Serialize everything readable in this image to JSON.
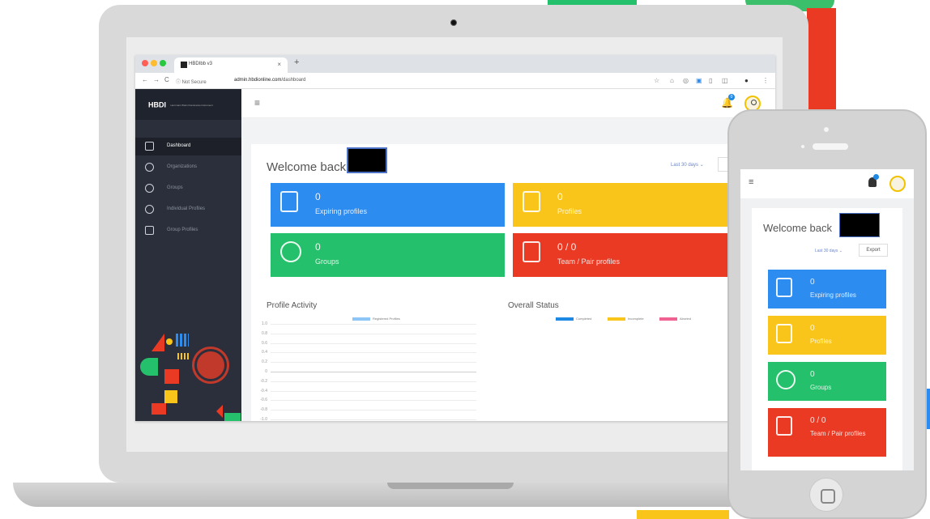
{
  "browser": {
    "tab_title": "HBDIbb v3",
    "tab_close": "×",
    "new_tab": "+",
    "nav_icons": [
      "←",
      "→",
      "C"
    ],
    "security_label": "ⓘ Not Secure",
    "url_host": "admin.hbdionline.com",
    "url_path": "/dashboard",
    "toolbar_icons": [
      "☆",
      "⌂",
      "◎",
      "▣",
      "▯",
      "◫",
      "●",
      "⋮"
    ]
  },
  "sidebar": {
    "brand": "HBDI",
    "brand_tagline": "Herrmann Brain Dominance Instrument",
    "items": [
      {
        "label": "Dashboard",
        "icon": "dashboard-icon"
      },
      {
        "label": "Organizations",
        "icon": "organization-icon"
      },
      {
        "label": "Groups",
        "icon": "groups-icon"
      },
      {
        "label": "Individual Profiles",
        "icon": "individual-profile-icon"
      },
      {
        "label": "Group Profiles",
        "icon": "group-profile-icon"
      }
    ]
  },
  "topbar": {
    "menu_glyph": "≡",
    "bell_glyph": "🔔",
    "notification_count": "0"
  },
  "dashboard": {
    "welcome": "Welcome back",
    "date_range": "Last 30 days ⌄",
    "cards": [
      {
        "value": "0",
        "label": "Expiring profiles",
        "color": "#2d8cf0"
      },
      {
        "value": "0",
        "label": "Profiles",
        "color": "#f9c51b"
      },
      {
        "value": "0",
        "label": "Groups",
        "color": "#25c06b"
      },
      {
        "value": "0 / 0",
        "label": "Team / Pair profiles",
        "color": "#ea3a24"
      }
    ],
    "profile_activity": {
      "title": "Profile Activity",
      "legend": "Registered Profiles",
      "yticks": [
        "1.0",
        "0.8",
        "0.6",
        "0.4",
        "0.2",
        "0",
        "-0.2",
        "-0.4",
        "-0.6",
        "-0.8",
        "-1.0"
      ]
    },
    "overall_status": {
      "title": "Overall Status",
      "legend": [
        {
          "label": "Completed",
          "color": "#1e88e5"
        },
        {
          "label": "Incomplete",
          "color": "#f9c51b"
        },
        {
          "label": "Aborted",
          "color": "#f06292"
        }
      ]
    }
  },
  "mobile": {
    "menu_glyph": "≡",
    "welcome": "Welcome back",
    "date_range": "Last 30 days ⌄",
    "export_label": "Export",
    "cards": [
      {
        "value": "0",
        "label": "Expiring profiles",
        "color": "#2d8cf0"
      },
      {
        "value": "0",
        "label": "Profiles",
        "color": "#f9c51b"
      },
      {
        "value": "0",
        "label": "Groups",
        "color": "#25c06b"
      },
      {
        "value": "0 / 0",
        "label": "Team / Pair profiles",
        "color": "#ea3a24"
      }
    ]
  }
}
